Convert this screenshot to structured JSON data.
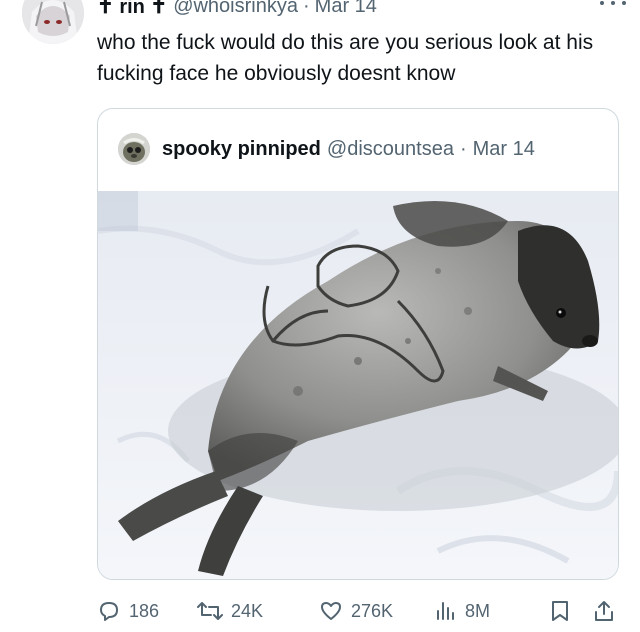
{
  "tweet": {
    "author_name": "✝ rin ✝",
    "author_handle": "@whoisrinkya",
    "separator": "·",
    "date": "Mar 14",
    "more_icon": "more-horizontal-icon",
    "text": "who the fuck would do this are you serious look at his fucking face he obviously doesnt know"
  },
  "quote": {
    "author_name": "spooky pinniped",
    "author_handle": "@discountsea",
    "separator": "·",
    "date": "Mar 14",
    "image_subject": "seal on snow"
  },
  "actions": {
    "replies": {
      "icon": "reply-icon",
      "count": "186"
    },
    "retweets": {
      "icon": "retweet-icon",
      "count": "24K"
    },
    "likes": {
      "icon": "heart-icon",
      "count": "276K"
    },
    "views": {
      "icon": "views-icon",
      "count": "8M"
    },
    "bookmark": {
      "icon": "bookmark-icon"
    },
    "share": {
      "icon": "share-icon"
    }
  },
  "colors": {
    "text": "#0f1419",
    "secondary": "#536471",
    "border": "#cfd9de"
  }
}
